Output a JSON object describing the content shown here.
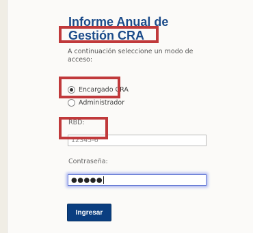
{
  "page": {
    "title": "Informe Anual de Gestión CRA",
    "intro": "A continuación seleccione un modo de acceso:"
  },
  "access_modes": [
    {
      "label": "Encargado CRA",
      "selected": true
    },
    {
      "label": "Administrador",
      "selected": false
    }
  ],
  "form": {
    "rbd_label": "RBD:",
    "rbd_value": "12345-6",
    "password_label": "Contraseña:",
    "password_value": "●●●●●",
    "submit_label": "Ingresar"
  },
  "colors": {
    "title": "#1b4b8a",
    "button": "#0a3e80",
    "highlight": "#c0393b",
    "focus_glow": "#a9b4f0"
  }
}
